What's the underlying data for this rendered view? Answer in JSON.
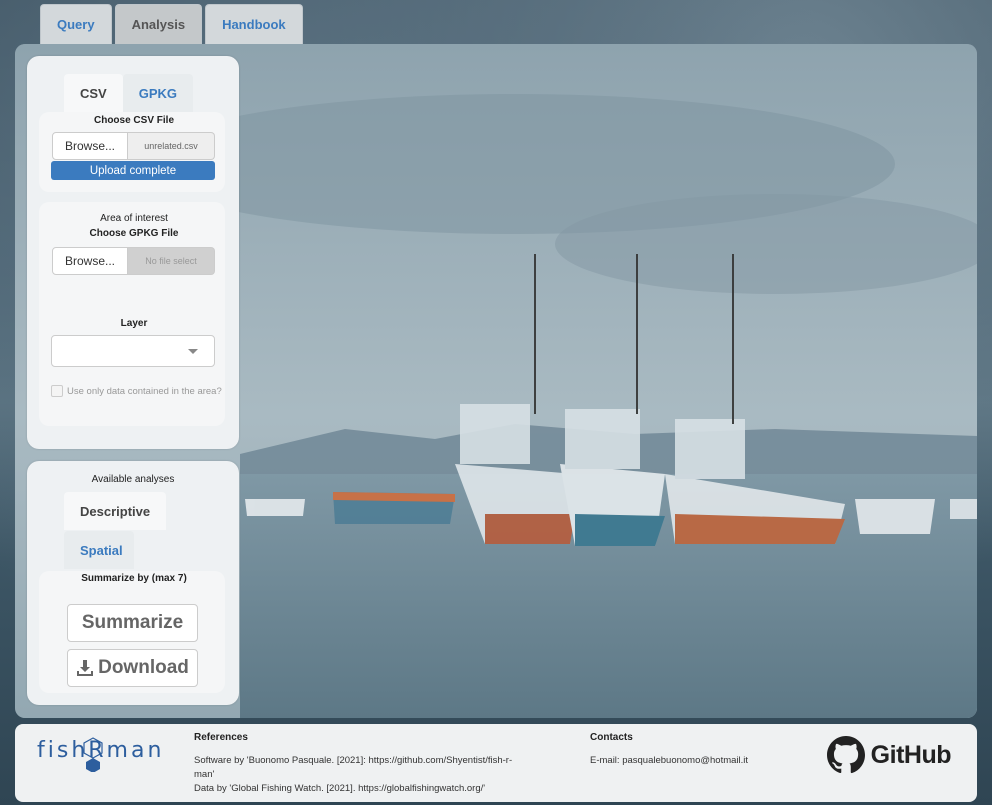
{
  "nav": {
    "tabs": [
      {
        "label": "Query"
      },
      {
        "label": "Analysis"
      },
      {
        "label": "Handbook"
      }
    ],
    "active": "Analysis"
  },
  "import_panel": {
    "tabs": [
      {
        "label": "CSV"
      },
      {
        "label": "GPKG"
      }
    ],
    "csv": {
      "label": "Choose CSV File",
      "browse_label": "Browse...",
      "file_name": "unrelated.csv",
      "progress_text": "Upload complete",
      "progress": 1.0
    },
    "gpkg": {
      "area_label": "Area of interest",
      "label": "Choose GPKG File",
      "browse_label": "Browse...",
      "file_placeholder": "No file select"
    },
    "layer": {
      "label": "Layer",
      "selected": ""
    },
    "checkbox": {
      "label": "Use only data contained in the area?",
      "checked": false
    }
  },
  "analysis_panel": {
    "title": "Available analyses",
    "tabs": [
      {
        "label": "Descriptive"
      },
      {
        "label": "Spatial"
      }
    ],
    "summarize_label": "Summarize by (max 7)",
    "summarize_button": "Summarize",
    "download_button": "Download"
  },
  "footer": {
    "logo": "fishRman",
    "references_title": "References",
    "ref_lines": [
      "Software by 'Buonomo Pasquale. [2021]: https://github.com/Shyentist/fish-r-",
      "man'",
      "Data by 'Global Fishing Watch. [2021]. https://globalfishingwatch.org/'"
    ],
    "contacts_title": "Contacts",
    "email": "E-mail: pasqualebuonomo@hotmail.it",
    "github_label": "GitHub"
  },
  "colors": {
    "accent": "#3b7bbf",
    "panel": "#eef1f3"
  },
  "icons": [
    "download-icon",
    "github-icon",
    "chevron-down-icon",
    "hexagon-logo-icon"
  ]
}
